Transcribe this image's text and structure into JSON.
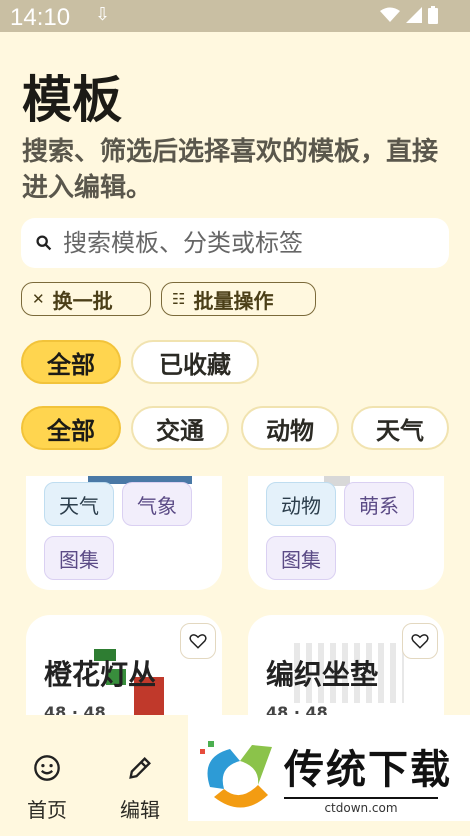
{
  "status": {
    "time": "14:10"
  },
  "page": {
    "title": "模板",
    "subtitle": "搜索、筛选后选择喜欢的模板，直接进入编辑。"
  },
  "search": {
    "placeholder": "搜索模板、分类或标签"
  },
  "actions": {
    "shuffle": "换一批",
    "batch": "批量操作"
  },
  "scope_filters": [
    {
      "label": "全部",
      "selected": true
    },
    {
      "label": "已收藏",
      "selected": false
    }
  ],
  "category_filters": [
    {
      "label": "全部",
      "selected": true
    },
    {
      "label": "交通",
      "selected": false
    },
    {
      "label": "动物",
      "selected": false
    },
    {
      "label": "天气",
      "selected": false
    }
  ],
  "cards_row1": [
    {
      "tags": [
        "天气",
        "气象",
        "图集"
      ]
    },
    {
      "tags": [
        "动物",
        "萌系",
        "图集"
      ]
    }
  ],
  "cards_row2": [
    {
      "title": "橙花灯丛",
      "meta": "48 · 48"
    },
    {
      "title": "编织坐垫",
      "meta": "48 · 48"
    }
  ],
  "bottom_nav": [
    {
      "label": "首页",
      "icon": "smile-icon"
    },
    {
      "label": "编辑",
      "icon": "edit-icon"
    }
  ],
  "watermark": {
    "text": "传统下载",
    "url": "ctdown.com"
  },
  "colors": {
    "background": "#FFF8DF",
    "accent": "#FFD54F"
  }
}
